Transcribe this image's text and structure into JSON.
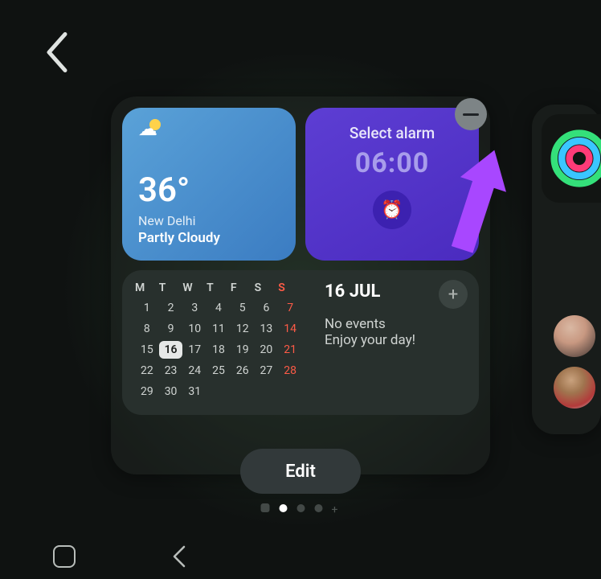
{
  "weather": {
    "temp": "36°",
    "city": "New Delhi",
    "condition": "Partly Cloudy"
  },
  "alarm": {
    "title": "Select alarm",
    "time": "06:00"
  },
  "calendar": {
    "dow": [
      "M",
      "T",
      "W",
      "T",
      "F",
      "S",
      "S"
    ],
    "today": 16,
    "days": [
      1,
      2,
      3,
      4,
      5,
      6,
      7,
      8,
      9,
      10,
      11,
      12,
      13,
      14,
      15,
      16,
      17,
      18,
      19,
      20,
      21,
      22,
      23,
      24,
      25,
      26,
      27,
      28,
      29,
      30,
      31
    ],
    "header_date": "16 JUL",
    "no_events": "No events",
    "enjoy": "Enjoy your day!"
  },
  "edit_label": "Edit",
  "page_indicator": {
    "active": 1,
    "count": 4
  }
}
